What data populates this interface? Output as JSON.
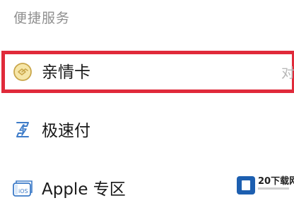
{
  "section": {
    "title": "便捷服务"
  },
  "items": [
    {
      "label": "亲情卡",
      "trailing": "对",
      "icon": "family-card-icon"
    },
    {
      "label": "极速付",
      "icon": "fast-pay-icon"
    },
    {
      "label": "Apple 专区",
      "icon": "ios-card-icon"
    }
  ],
  "watermark": {
    "text": "20下载网"
  },
  "colors": {
    "highlight_border": "#e02a3a",
    "icon_gold": "#c9a64a",
    "icon_blue": "#3d7bc8"
  }
}
